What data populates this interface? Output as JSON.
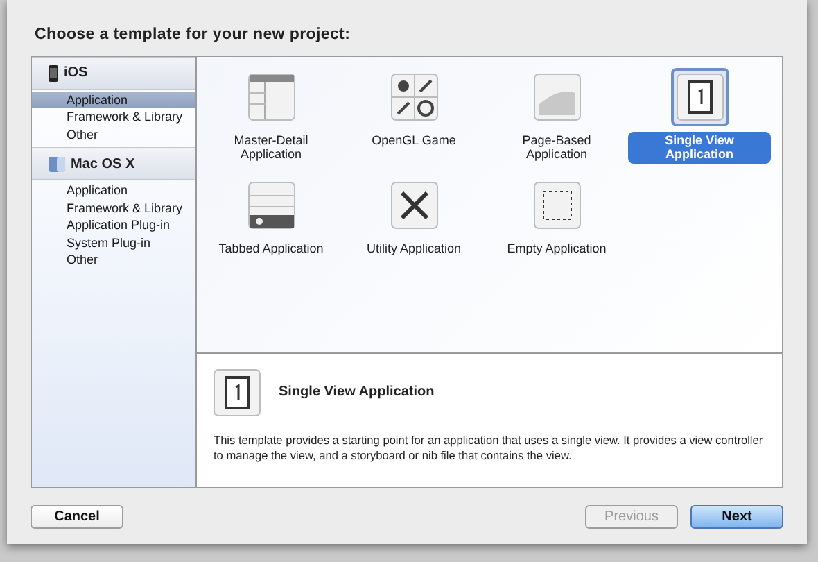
{
  "title": "Choose a template for your new project:",
  "sidebar": {
    "sections": [
      {
        "header": "iOS",
        "kind": "ios",
        "items": [
          {
            "label": "Application",
            "selected": true
          },
          {
            "label": "Framework & Library",
            "selected": false
          },
          {
            "label": "Other",
            "selected": false
          }
        ]
      },
      {
        "header": "Mac OS X",
        "kind": "mac",
        "items": [
          {
            "label": "Application",
            "selected": false
          },
          {
            "label": "Framework & Library",
            "selected": false
          },
          {
            "label": "Application Plug-in",
            "selected": false
          },
          {
            "label": "System Plug-in",
            "selected": false
          },
          {
            "label": "Other",
            "selected": false
          }
        ]
      }
    ]
  },
  "templates": [
    {
      "label": "Master-Detail Application",
      "kind": "master-detail",
      "selected": false
    },
    {
      "label": "OpenGL Game",
      "kind": "opengl",
      "selected": false
    },
    {
      "label": "Page-Based Application",
      "kind": "page",
      "selected": false
    },
    {
      "label": "Single View Application",
      "kind": "single",
      "selected": true
    },
    {
      "label": "Tabbed Application",
      "kind": "tabbed",
      "selected": false
    },
    {
      "label": "Utility Application",
      "kind": "utility",
      "selected": false
    },
    {
      "label": "Empty Application",
      "kind": "empty",
      "selected": false
    }
  ],
  "detail": {
    "kind": "single",
    "title": "Single View Application",
    "description": "This template provides a starting point for an application that uses a single view. It provides a view controller to manage the view, and a storyboard or nib file that contains the view."
  },
  "buttons": {
    "left": [
      {
        "label": "Cancel",
        "disabled": false,
        "default": false
      }
    ],
    "right": [
      {
        "label": "Previous",
        "disabled": true,
        "default": false
      },
      {
        "label": "Next",
        "disabled": false,
        "default": true
      }
    ]
  }
}
